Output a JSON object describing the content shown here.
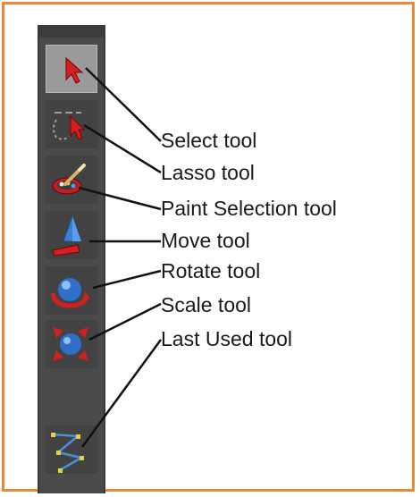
{
  "labels": {
    "select": "Select tool",
    "lasso": "Lasso tool",
    "paint_selection": "Paint Selection tool",
    "move": "Move tool",
    "rotate": "Rotate tool",
    "scale": "Scale tool",
    "last_used": "Last Used tool"
  },
  "icons": {
    "select": "select-arrow-icon",
    "lasso": "lasso-icon",
    "paint_selection": "paint-brush-icon",
    "move": "move-cone-icon",
    "rotate": "rotate-sphere-icon",
    "scale": "scale-cube-icon",
    "last_used": "curve-path-icon"
  },
  "colors": {
    "frame": "#e8893a",
    "toolbar": "#4a4a4a",
    "active_tool": "#9a9a9a",
    "leader_line": "#111111"
  }
}
